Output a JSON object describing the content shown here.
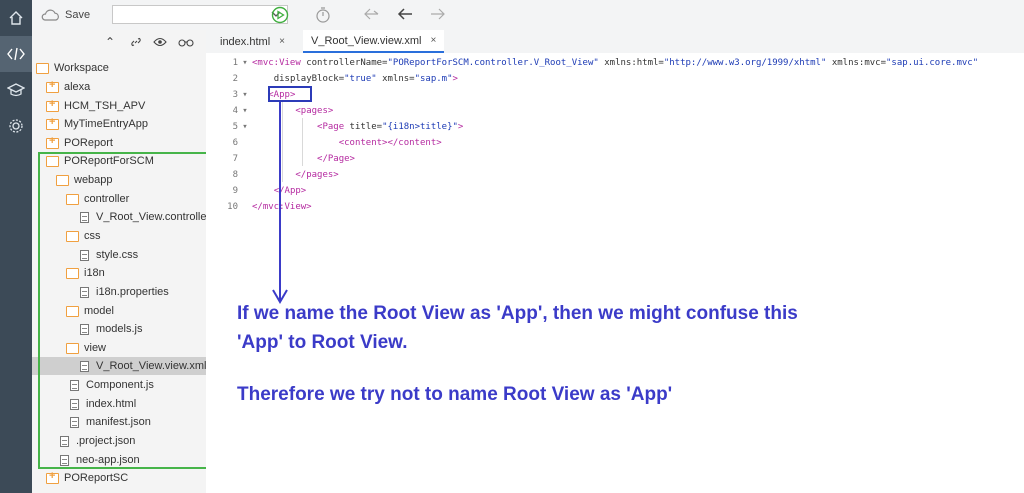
{
  "toolbar": {
    "save_label": "Save"
  },
  "tabs": [
    {
      "label": "index.html",
      "close": "×"
    },
    {
      "label": "V_Root_View.view.xml",
      "close": "×"
    }
  ],
  "tree": {
    "items": [
      {
        "label": "Workspace",
        "kind": "folder-open"
      },
      {
        "label": "alexa",
        "kind": "folder-plus"
      },
      {
        "label": "HCM_TSH_APV",
        "kind": "folder-plus"
      },
      {
        "label": "MyTimeEntryApp",
        "kind": "folder-plus"
      },
      {
        "label": "POReport",
        "kind": "folder-plus"
      },
      {
        "label": "POReportForSCM",
        "kind": "folder-open"
      },
      {
        "label": "webapp",
        "kind": "folder-open"
      },
      {
        "label": "controller",
        "kind": "folder-open"
      },
      {
        "label": "V_Root_View.controller.js",
        "kind": "file"
      },
      {
        "label": "css",
        "kind": "folder-open"
      },
      {
        "label": "style.css",
        "kind": "file"
      },
      {
        "label": "i18n",
        "kind": "folder-open"
      },
      {
        "label": "i18n.properties",
        "kind": "file"
      },
      {
        "label": "model",
        "kind": "folder-open"
      },
      {
        "label": "models.js",
        "kind": "file"
      },
      {
        "label": "view",
        "kind": "folder-open"
      },
      {
        "label": "V_Root_View.view.xml",
        "kind": "file",
        "selected": true
      },
      {
        "label": "Component.js",
        "kind": "file"
      },
      {
        "label": "index.html",
        "kind": "file"
      },
      {
        "label": "manifest.json",
        "kind": "file"
      },
      {
        "label": ".project.json",
        "kind": "file"
      },
      {
        "label": "neo-app.json",
        "kind": "file"
      },
      {
        "label": "POReportSC",
        "kind": "folder-plus"
      }
    ]
  },
  "code": {
    "lines": [
      {
        "num": "1",
        "fold": "▾"
      },
      {
        "num": "2",
        "fold": ""
      },
      {
        "num": "3",
        "fold": "▾"
      },
      {
        "num": "4",
        "fold": "▾"
      },
      {
        "num": "5",
        "fold": "▾"
      },
      {
        "num": "6",
        "fold": ""
      },
      {
        "num": "7",
        "fold": ""
      },
      {
        "num": "8",
        "fold": ""
      },
      {
        "num": "9",
        "fold": ""
      },
      {
        "num": "10",
        "fold": ""
      }
    ],
    "l1_tag": "<mvc:View",
    "l1_attr1": " controllerName=",
    "l1_val1": "\"POReportForSCM.controller.V_Root_View\"",
    "l1_attr2": " xmlns:html=",
    "l1_val2": "\"http://www.w3.org/1999/xhtml\"",
    "l1_attr3": " xmlns:mvc=",
    "l1_val3": "\"sap.ui.core.mvc\"",
    "l2_attr1": "displayBlock=",
    "l2_val1": "\"true\"",
    "l2_attr2": " xmlns=",
    "l2_val2": "\"sap.m\"",
    "l2_end": ">",
    "l3": "<App>",
    "l4": "<pages>",
    "l5_tag": "<Page",
    "l5_attr": " title=",
    "l5_val": "\"{i18n>title}\"",
    "l5_end": ">",
    "l6": "<content></content>",
    "l7": "</Page>",
    "l8": "</pages>",
    "l9": "</App>",
    "l10": "</mvc:View>"
  },
  "annotation": {
    "line1": "If we name the Root View as 'App', then we might confuse this",
    "line2": "'App' to Root View.",
    "line3": "Therefore we try not to name Root View as 'App'"
  },
  "colors": {
    "annotation": "#3b3bc8",
    "highlight_box": "#2c3bb8",
    "tree_box": "#46b449",
    "tag": "#b52aa0",
    "string": "#1d3bb5"
  }
}
